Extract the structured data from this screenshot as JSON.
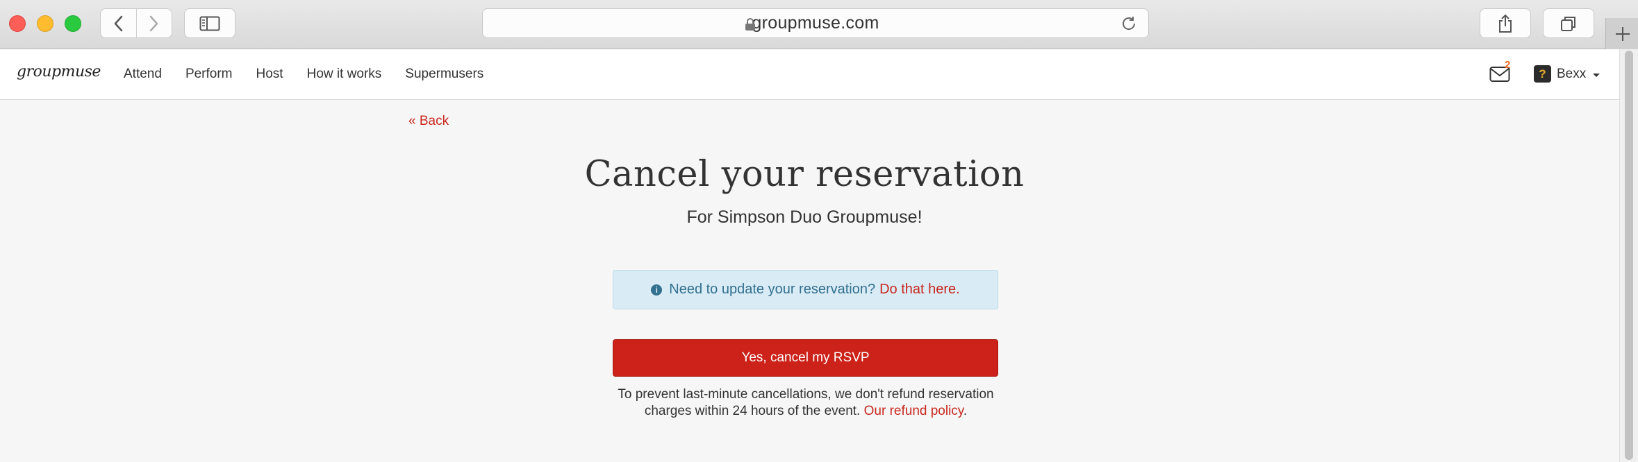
{
  "browser": {
    "url": "groupmuse.com"
  },
  "site": {
    "logo": "groupmuse",
    "nav": [
      "Attend",
      "Perform",
      "Host",
      "How it works",
      "Supermusers"
    ],
    "mail_badge": "2",
    "user_initial": "?",
    "username": "Bexx"
  },
  "page": {
    "back_link": "« Back",
    "title": "Cancel your reservation",
    "subtitle": "For Simpson Duo Groupmuse!",
    "alert_text": "Need to update your reservation?",
    "alert_link": "Do that here.",
    "cancel_button": "Yes, cancel my RSVP",
    "note_text": "To prevent last-minute cancellations, we don't refund reservation charges within 24 hours of the event.",
    "note_link": "Our refund policy",
    "note_end": "."
  },
  "colors": {
    "brand_red": "#cc2219",
    "link_red": "#c9271e",
    "alert_bg": "#d9ebf5",
    "alert_text": "#31708f"
  },
  "icons": [
    "back-arrow-icon",
    "forward-arrow-icon",
    "sidebar-icon",
    "lock-icon",
    "reload-icon",
    "share-icon",
    "tabs-icon",
    "plus-icon",
    "mail-icon",
    "info-icon",
    "caret-down-icon"
  ]
}
